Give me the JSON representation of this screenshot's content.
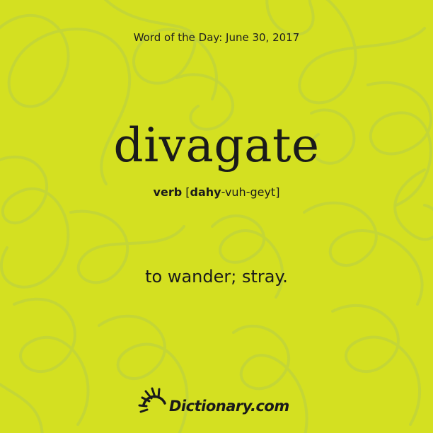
{
  "header": {
    "text": "Word of the Day: June 30, 2017"
  },
  "entry": {
    "word": "divagate",
    "part_of_speech": "verb",
    "pron_open": "[",
    "pron_stressed": "dahy",
    "pron_rest": "-vuh-geyt",
    "pron_close": "]",
    "definition": "to wander; stray."
  },
  "brand": {
    "name": "Dictionary.com",
    "icon": "sunburst-logo-icon"
  },
  "colors": {
    "background": "#d4e021",
    "swirl": "#c1d43a",
    "text": "#1a1a1a"
  }
}
